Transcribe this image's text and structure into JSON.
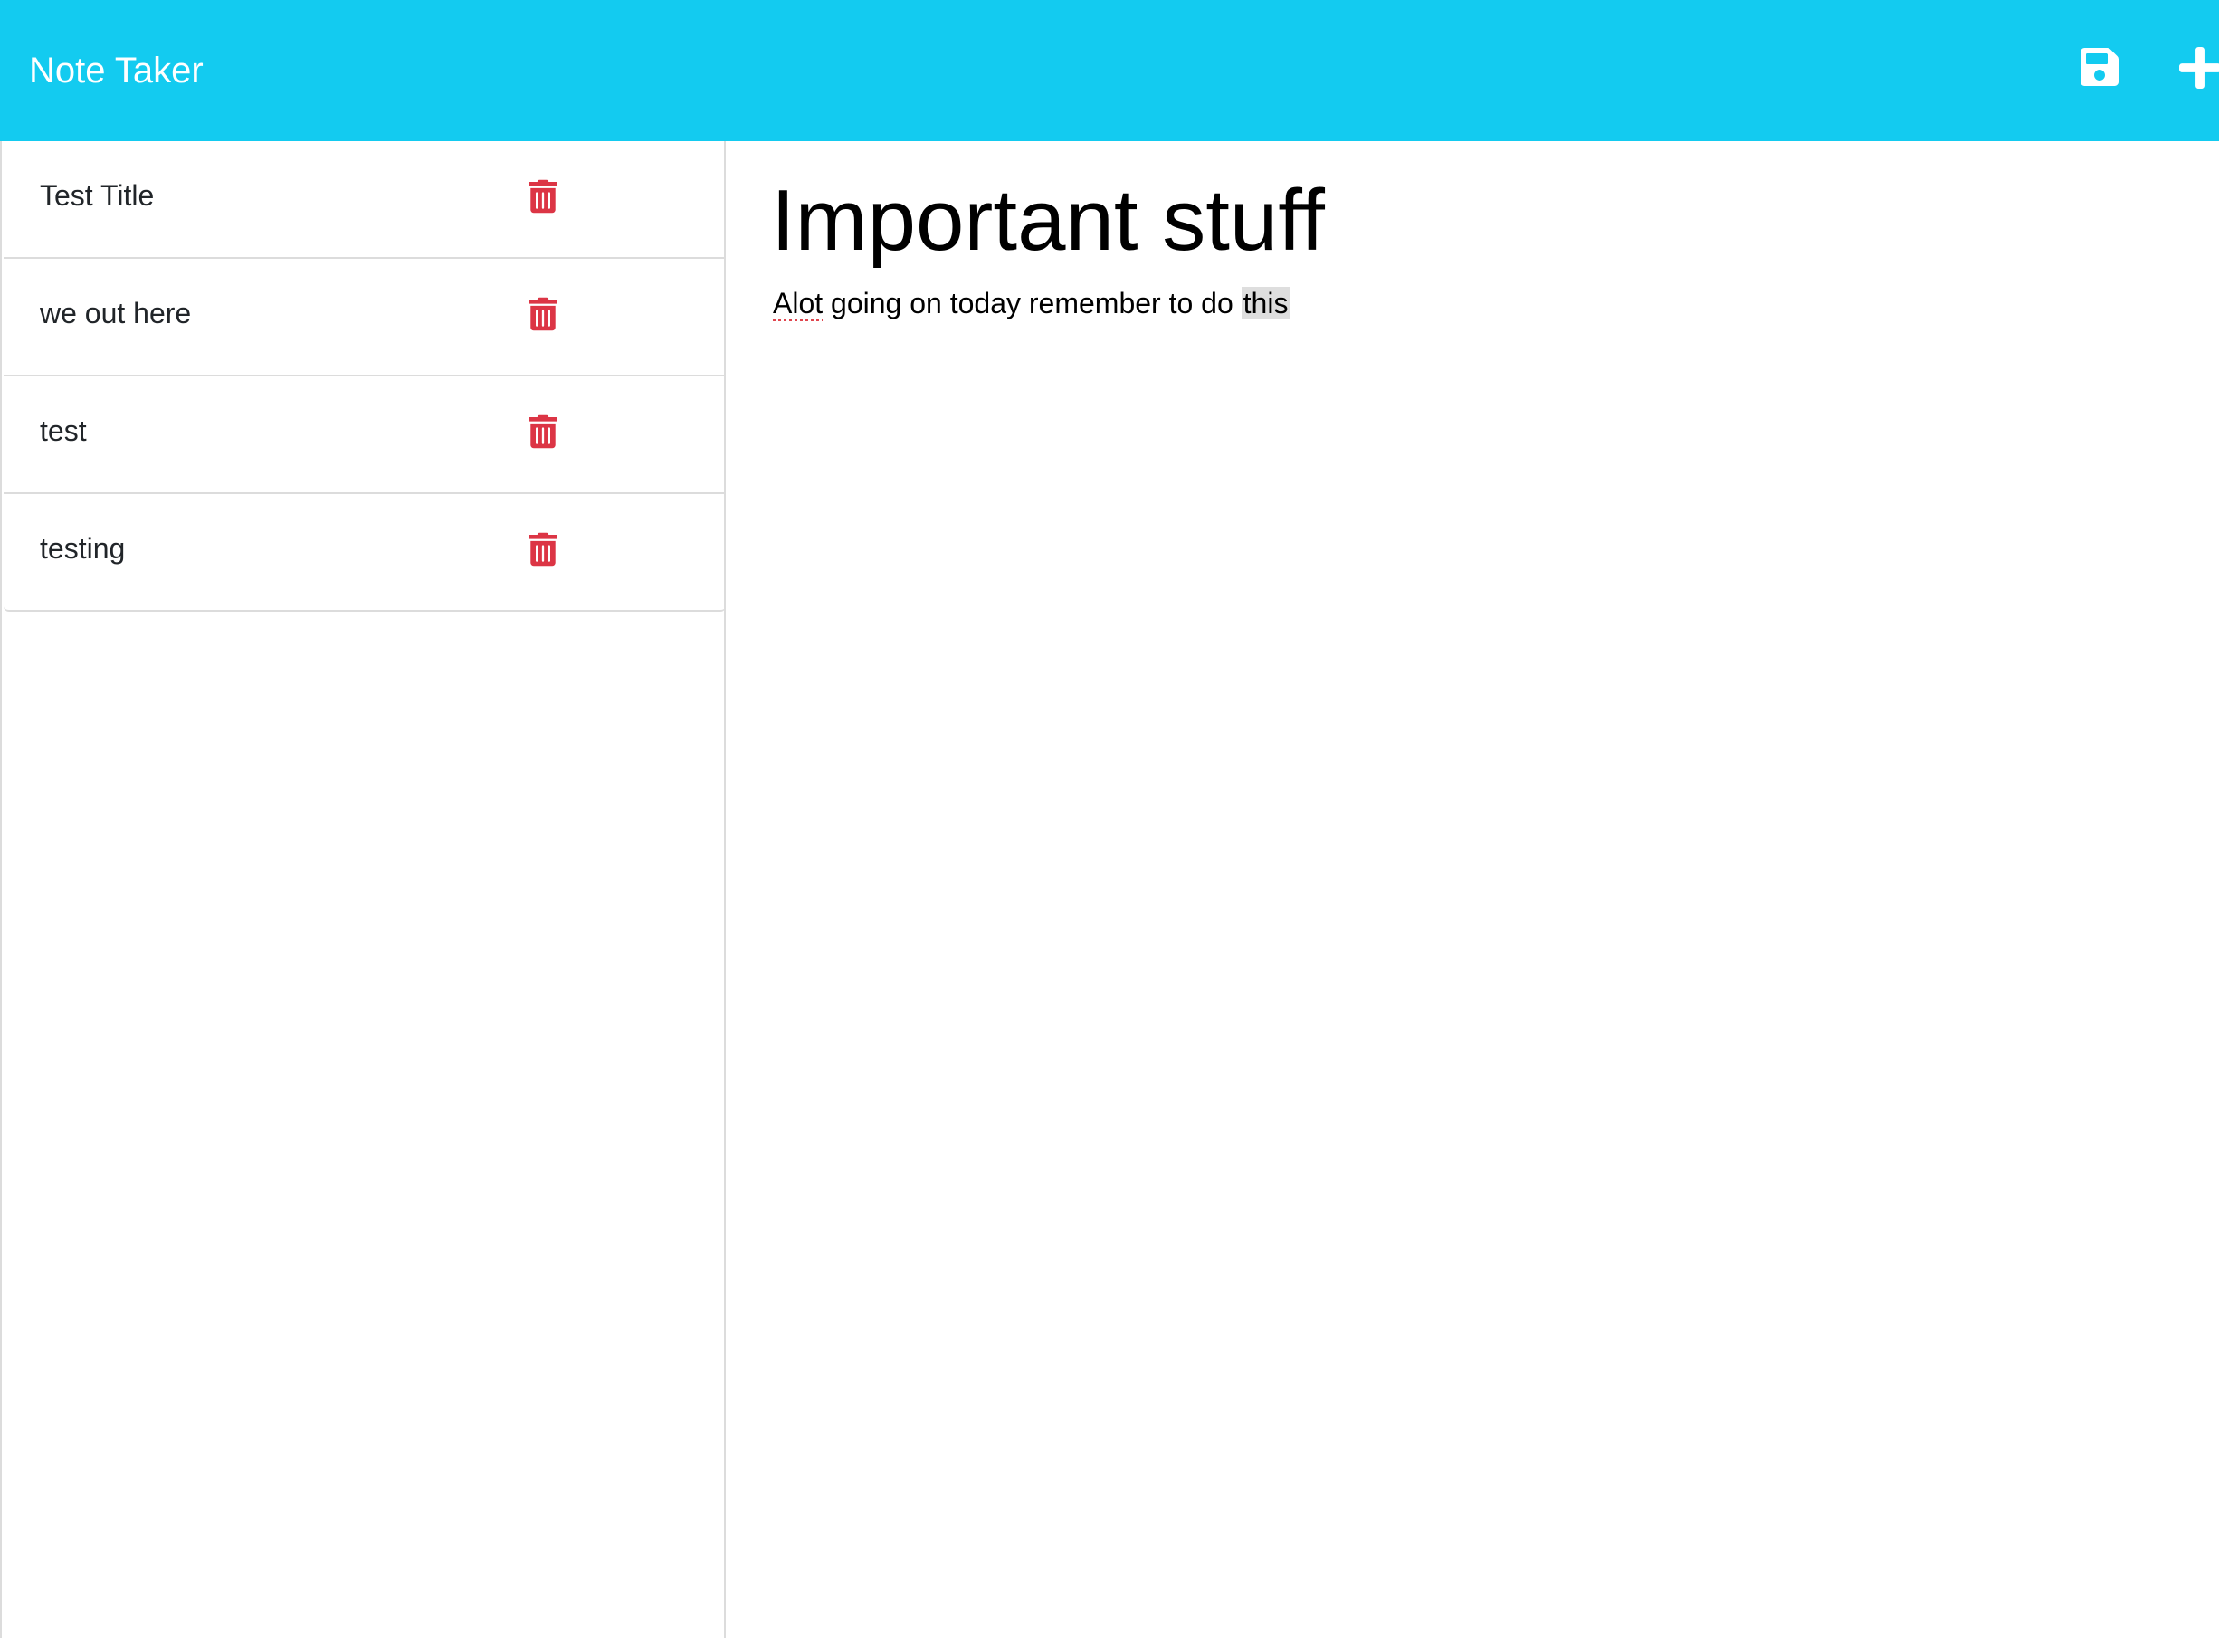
{
  "app": {
    "title": "Note Taker",
    "accent_color": "#13cbf0",
    "delete_color": "#dc3545"
  },
  "toolbar": {
    "save_icon": "save-icon",
    "new_note_icon": "plus-icon"
  },
  "notes": [
    {
      "title": "Test Title",
      "icon": "trash-icon"
    },
    {
      "title": "we out here",
      "icon": "trash-icon"
    },
    {
      "title": "test",
      "icon": "trash-icon"
    },
    {
      "title": "testing",
      "icon": "trash-icon"
    }
  ],
  "active_note": {
    "title": "Important stuff",
    "text_before": "Alot",
    "text_middle": " going on today remember to do ",
    "text_selected": "this"
  }
}
